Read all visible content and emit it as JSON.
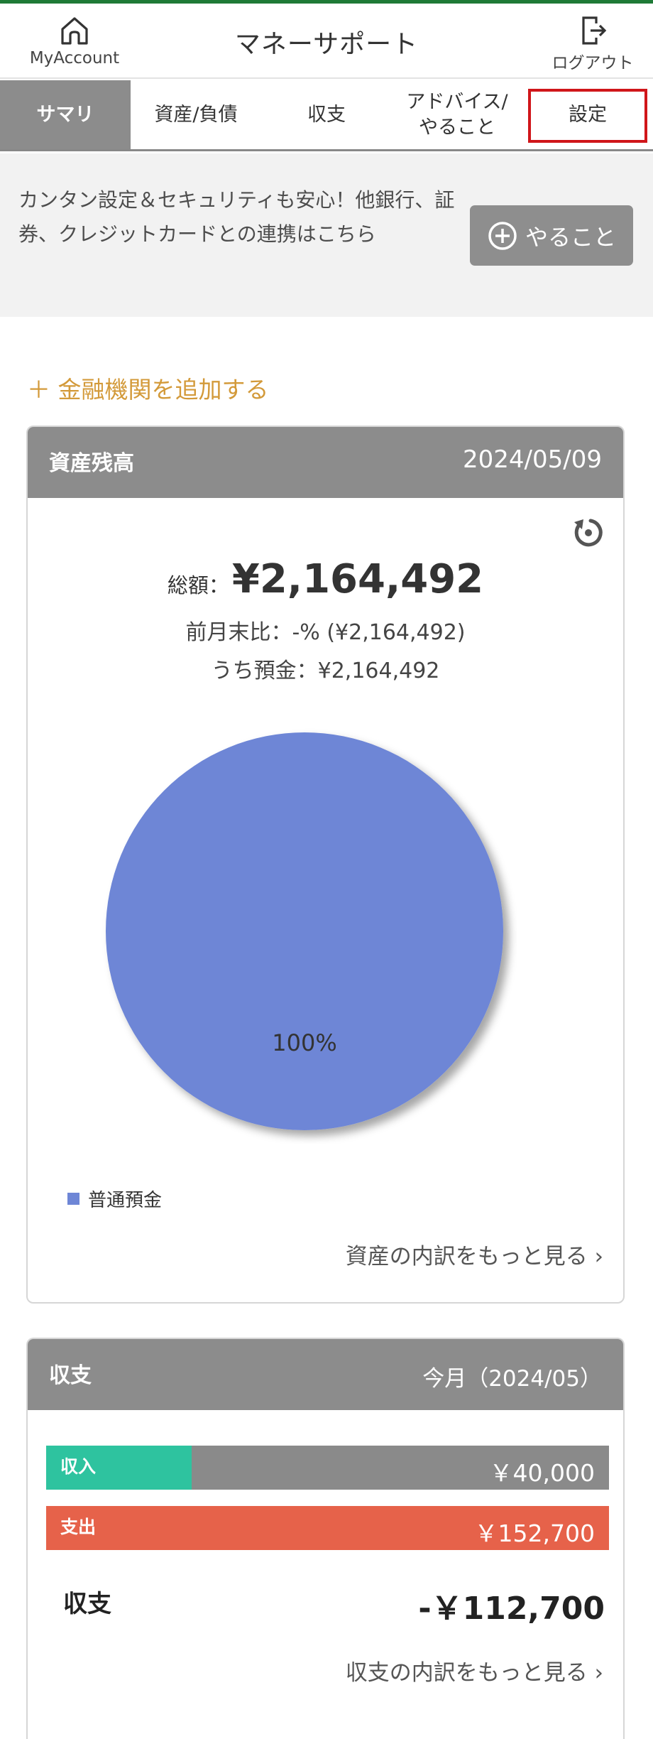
{
  "header": {
    "home_label": "MyAccount",
    "title": "マネーサポート",
    "logout_label": "ログアウト"
  },
  "tabs": [
    {
      "label": "サマリ",
      "active": true
    },
    {
      "label": "資産/負債"
    },
    {
      "label": "収支"
    },
    {
      "label": "アドバイス/\nやること"
    },
    {
      "label": "設定",
      "highlighted": true
    }
  ],
  "notice": {
    "text": "カンタン設定＆セキュリティも安心！他銀行、証券、クレジットカードとの連携はこちら",
    "todo_button": "やること"
  },
  "add_institution": "＋ 金融機関を追加する",
  "assets": {
    "title": "資産残高",
    "date": "2024/05/09",
    "total_label": "総額：",
    "total_value": "¥2,164,492",
    "month_compare": "前月末比：-% (¥2,164,492)",
    "deposit": "うち預金：¥2,164,492",
    "more_link": "資産の内訳をもっと見る ›"
  },
  "chart_data": {
    "type": "pie",
    "slices": [
      {
        "label": "普通預金",
        "value": 100,
        "display": "100%",
        "color": "#6e86d6"
      }
    ],
    "legend": "bottom-left"
  },
  "cashflow": {
    "title": "収支",
    "period": "今月（2024/05）",
    "income_label": "収入",
    "income_value": "￥40,000",
    "expense_label": "支出",
    "expense_value": "￥152,700",
    "net_label": "収支",
    "net_value": "-￥112,700",
    "more_link": "収支の内訳をもっと見る ›"
  },
  "colors": {
    "accent_green": "#1e7a36",
    "highlight_red": "#d0161a",
    "income": "#2ec39f",
    "expense": "#e6624a",
    "link_orange": "#d39a3a"
  }
}
